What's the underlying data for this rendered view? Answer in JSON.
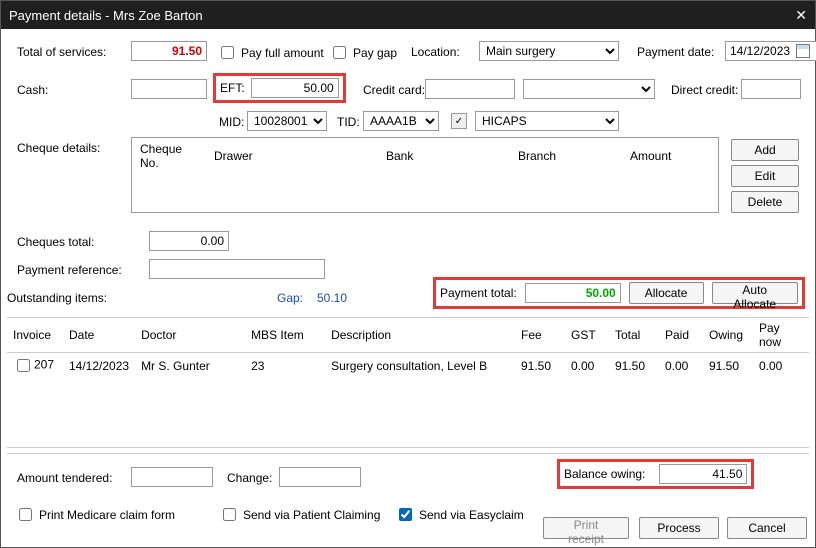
{
  "titlebar": {
    "title": "Payment details - Mrs Zoe Barton"
  },
  "top": {
    "total_services_label": "Total of services:",
    "total_services_value": "91.50",
    "pay_full_label": "Pay full amount",
    "pay_gap_label": "Pay gap",
    "location_label": "Location:",
    "location_value": "Main surgery",
    "payment_date_label": "Payment date:",
    "payment_date_value": "14/12/2023"
  },
  "pay_row": {
    "cash_label": "Cash:",
    "cash_value": "",
    "eft_label": "EFT:",
    "eft_value": "50.00",
    "credit_card_label": "Credit card:",
    "credit_card_value": "",
    "credit_type_value": "",
    "direct_credit_label": "Direct credit:",
    "direct_credit_value": ""
  },
  "mid_row": {
    "mid_label": "MID:",
    "mid_value": "10028001",
    "tid_label": "TID:",
    "tid_value": "AAAA1B",
    "hicaps_value": "HICAPS"
  },
  "cheque": {
    "section_label": "Cheque details:",
    "col_no": "Cheque No.",
    "col_drawer": "Drawer",
    "col_bank": "Bank",
    "col_branch": "Branch",
    "col_amount": "Amount",
    "add": "Add",
    "edit": "Edit",
    "delete": "Delete",
    "total_label": "Cheques total:",
    "total_value": "0.00"
  },
  "reference": {
    "label": "Payment reference:",
    "value": ""
  },
  "outstanding": {
    "label": "Outstanding items:",
    "gap_label": "Gap:",
    "gap_value": "50.10",
    "payment_total_label": "Payment total:",
    "payment_total_value": "50.00",
    "allocate": "Allocate",
    "auto_allocate": "Auto Allocate"
  },
  "items": {
    "headers": {
      "invoice": "Invoice",
      "date": "Date",
      "doctor": "Doctor",
      "mbs": "MBS Item",
      "desc": "Description",
      "fee": "Fee",
      "gst": "GST",
      "total": "Total",
      "paid": "Paid",
      "owing": "Owing",
      "paynow": "Pay now"
    },
    "rows": [
      {
        "invoice": "207",
        "date": "14/12/2023",
        "doctor": "Mr S. Gunter",
        "mbs": "23",
        "desc": "Surgery consultation, Level B",
        "fee": "91.50",
        "gst": "0.00",
        "total": "91.50",
        "paid": "0.00",
        "owing": "91.50",
        "paynow": "0.00"
      }
    ]
  },
  "footer": {
    "amount_tendered_label": "Amount tendered:",
    "amount_tendered_value": "",
    "change_label": "Change:",
    "change_value": "",
    "balance_owing_label": "Balance owing:",
    "balance_owing_value": "41.50",
    "print_medicare": "Print Medicare claim form",
    "send_patient": "Send via Patient Claiming",
    "send_easy": "Send via Easyclaim",
    "print_receipt": "Print receipt",
    "process": "Process",
    "cancel": "Cancel"
  }
}
